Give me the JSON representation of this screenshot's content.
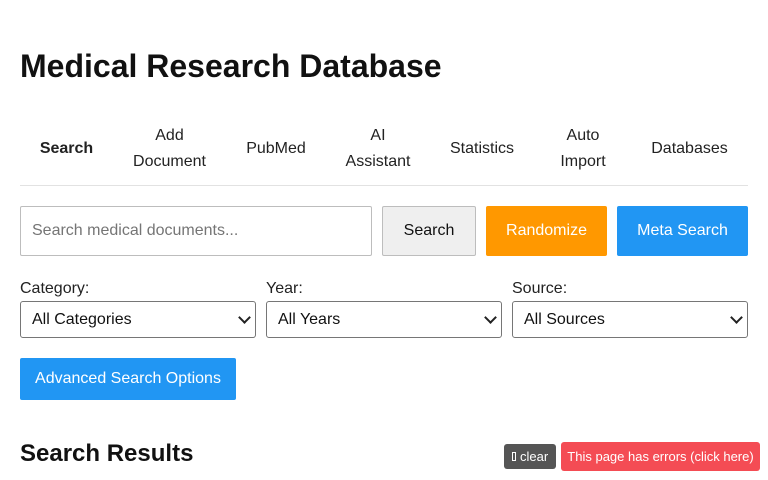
{
  "header": {
    "title": "Medical Research Database"
  },
  "nav": {
    "items": [
      {
        "label": "Search"
      },
      {
        "label": "Add\nDocument"
      },
      {
        "label": "PubMed"
      },
      {
        "label": "AI\nAssistant"
      },
      {
        "label": "Statistics"
      },
      {
        "label": "Auto\nImport"
      },
      {
        "label": "Databases"
      }
    ]
  },
  "search": {
    "placeholder": "Search medical documents...",
    "value": "",
    "search_label": "Search",
    "randomize_label": "Randomize",
    "meta_search_label": "Meta Search"
  },
  "filters": {
    "category": {
      "label": "Category:",
      "selected": "All Categories"
    },
    "year": {
      "label": "Year:",
      "selected": "All Years"
    },
    "source": {
      "label": "Source:",
      "selected": "All Sources"
    }
  },
  "advanced_label": "Advanced Search Options",
  "results": {
    "title": "Search Results"
  },
  "overlay": {
    "clear_label": "clear",
    "error_label": "This page has errors (click here)"
  },
  "colors": {
    "accent": "#2196f3",
    "randomize": "#ff9800",
    "error": "#f44c54",
    "clear": "#555555"
  },
  "icons": {
    "clear": "clear-box-icon",
    "select": "chevron-down-icon"
  }
}
